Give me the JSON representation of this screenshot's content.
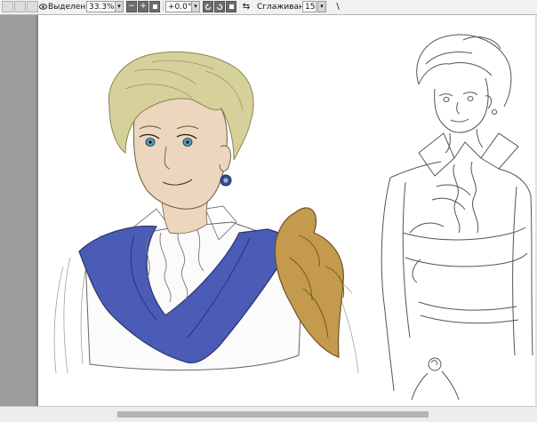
{
  "toolbar": {
    "selection_label": "Выделение",
    "zoom_value": "33.3%",
    "zoom_minus": "−",
    "zoom_plus": "+",
    "rotation_value": "+0.0°",
    "smoothing_label": "Сглаживание",
    "smoothing_value": "15",
    "dropdown_glyph": "▾",
    "flip_glyph": "⇆",
    "pen_glyph": "\\"
  },
  "icons": [
    "eye-icon",
    "minus-icon",
    "plus-icon",
    "reset-zoom-icon",
    "rotate-left-icon",
    "rotate-right-icon",
    "reset-rotation-icon",
    "flip-icon",
    "pen-icon"
  ],
  "colors": {
    "toolbar_bg": "#f1f1f1",
    "canvas_bg": "#ffffff",
    "workspace_bg": "#9c9c9c",
    "cape_blue": "#4a5cb5",
    "pauldron_gold": "#c39a4e",
    "hair_blond": "#d6d09b",
    "skin": "#ecd6bd",
    "sketch_line": "#555555"
  }
}
